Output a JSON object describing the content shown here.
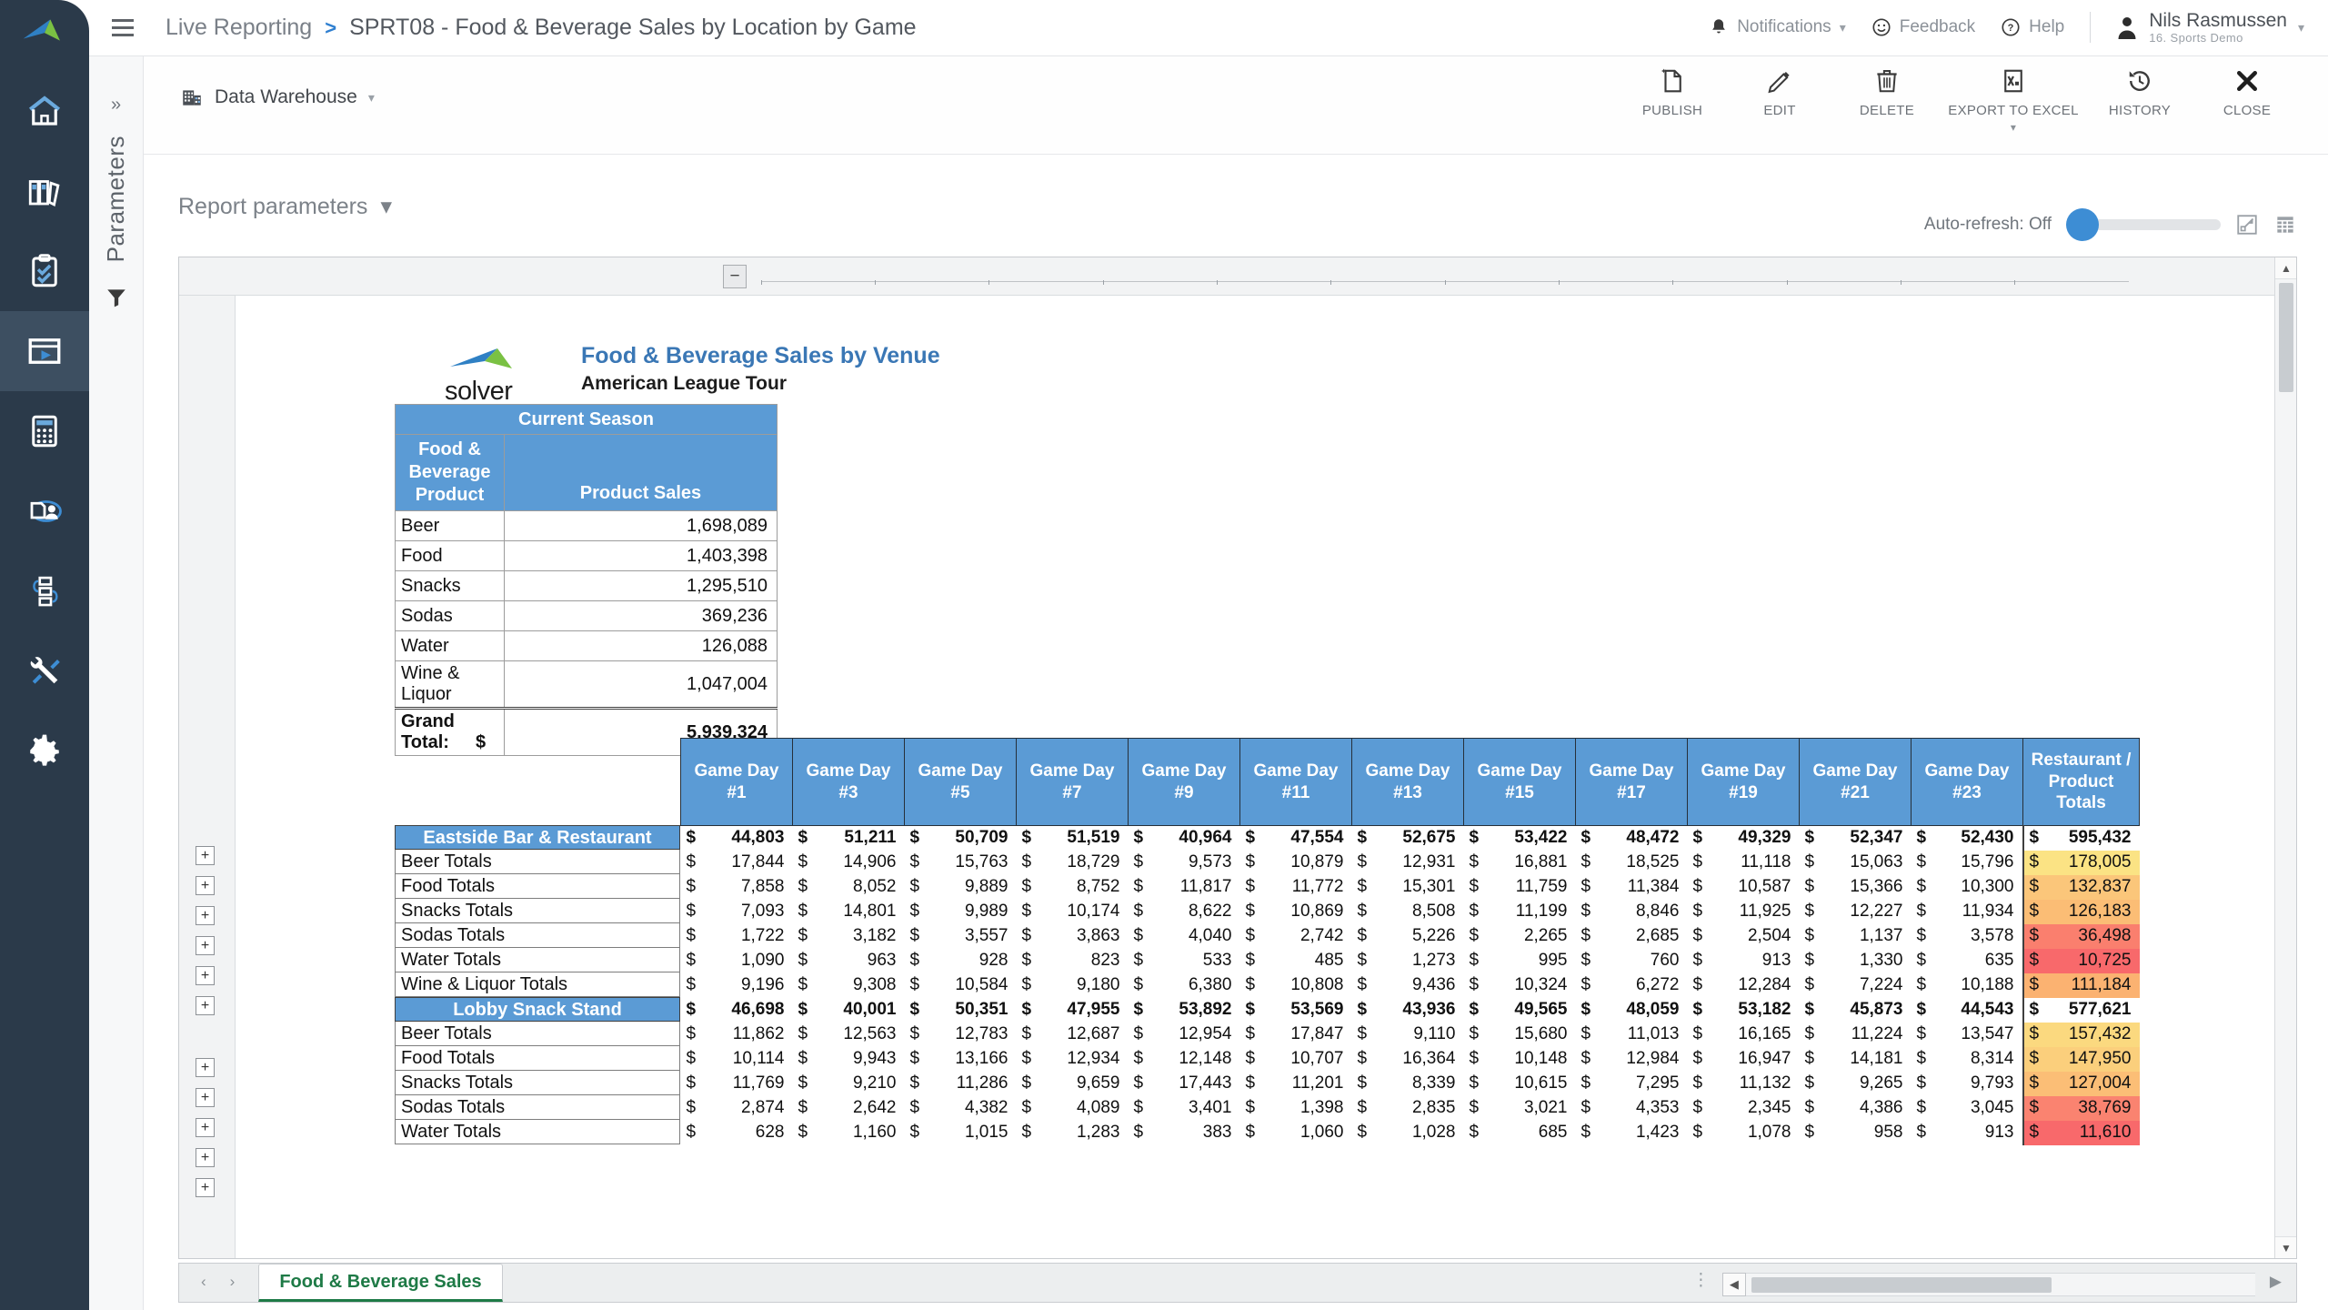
{
  "topbar": {
    "breadcrumb_root": "Live Reporting",
    "breadcrumb_sep": ">",
    "breadcrumb_current": "SPRT08 - Food & Beverage Sales by Location by Game",
    "notifications": "Notifications",
    "feedback": "Feedback",
    "help": "Help",
    "user_name": "Nils Rasmussen",
    "user_org": "16. Sports Demo"
  },
  "actionbar": {
    "datasource": "Data Warehouse",
    "actions": [
      {
        "label": "PUBLISH",
        "icon": "publish-icon"
      },
      {
        "label": "EDIT",
        "icon": "edit-icon"
      },
      {
        "label": "DELETE",
        "icon": "delete-icon"
      },
      {
        "label": "EXPORT TO EXCEL",
        "icon": "excel-icon"
      },
      {
        "label": "HISTORY",
        "icon": "history-icon"
      },
      {
        "label": "CLOSE",
        "icon": "close-icon"
      }
    ]
  },
  "parameters_panel": {
    "label": "Parameters"
  },
  "report": {
    "params_toggle": "Report parameters",
    "auto_refresh": "Auto-refresh: Off",
    "brand": "solver",
    "title": "Food & Beverage Sales by Venue",
    "subtitle": "American League Tour"
  },
  "summary": {
    "season_header": "Current Season",
    "col1_header": "Food & Beverage Product",
    "col2_header": "Product Sales",
    "rows": [
      {
        "label": "Beer",
        "value": "1,698,089"
      },
      {
        "label": "Food",
        "value": "1,403,398"
      },
      {
        "label": "Snacks",
        "value": "1,295,510"
      },
      {
        "label": "Sodas",
        "value": "369,236"
      },
      {
        "label": "Water",
        "value": "126,088"
      },
      {
        "label": "Wine & Liquor",
        "value": "1,047,004"
      }
    ],
    "total_label": "Grand Total:",
    "total_symbol": "$",
    "total_value": "5,939,324"
  },
  "chart_data": {
    "type": "table",
    "title": "Food & Beverage Sales by Venue",
    "columns": [
      "Game Day #1",
      "Game Day #3",
      "Game Day #5",
      "Game Day #7",
      "Game Day #9",
      "Game Day #11",
      "Game Day #13",
      "Game Day #15",
      "Game Day #17",
      "Game Day #19",
      "Game Day #21",
      "Game Day #23",
      "Restaurant / Product Totals"
    ],
    "currency_symbol": "$",
    "groups": [
      {
        "name": "Eastside Bar & Restaurant",
        "rows": [
          {
            "label": "Eastside Bar & Restaurant",
            "is_group_total": true,
            "values": [
              "44,803",
              "51,211",
              "50,709",
              "51,519",
              "40,964",
              "47,554",
              "52,675",
              "53,422",
              "48,472",
              "49,329",
              "52,347",
              "52,430"
            ],
            "total": "595,432",
            "total_color": "#ffffff"
          },
          {
            "label": "Beer Totals",
            "is_group_total": false,
            "values": [
              "17,844",
              "14,906",
              "15,763",
              "18,729",
              "9,573",
              "10,879",
              "12,931",
              "16,881",
              "18,525",
              "11,118",
              "15,063",
              "15,796"
            ],
            "total": "178,005",
            "total_color": "#fbe384"
          },
          {
            "label": "Food Totals",
            "is_group_total": false,
            "values": [
              "7,858",
              "8,052",
              "9,889",
              "8,752",
              "11,817",
              "11,772",
              "15,301",
              "11,759",
              "11,384",
              "10,587",
              "15,366",
              "10,300"
            ],
            "total": "132,837",
            "total_color": "#fbc67a"
          },
          {
            "label": "Snacks Totals",
            "is_group_total": false,
            "values": [
              "7,093",
              "14,801",
              "9,989",
              "10,174",
              "8,622",
              "10,869",
              "8,508",
              "11,199",
              "8,846",
              "11,925",
              "12,227",
              "11,934"
            ],
            "total": "126,183",
            "total_color": "#fbbd75"
          },
          {
            "label": "Sodas Totals",
            "is_group_total": false,
            "values": [
              "1,722",
              "3,182",
              "3,557",
              "3,863",
              "4,040",
              "2,742",
              "5,226",
              "2,265",
              "2,685",
              "2,504",
              "1,137",
              "3,578"
            ],
            "total": "36,498",
            "total_color": "#fa7f6e"
          },
          {
            "label": "Water Totals",
            "is_group_total": false,
            "values": [
              "1,090",
              "963",
              "928",
              "823",
              "533",
              "485",
              "1,273",
              "995",
              "760",
              "913",
              "1,330",
              "635"
            ],
            "total": "10,725",
            "total_color": "#f8696b"
          },
          {
            "label": "Wine & Liquor Totals",
            "is_group_total": false,
            "values": [
              "9,196",
              "9,308",
              "10,584",
              "9,180",
              "6,380",
              "10,808",
              "9,436",
              "10,324",
              "6,272",
              "12,284",
              "7,224",
              "10,188"
            ],
            "total": "111,184",
            "total_color": "#fbb271"
          }
        ]
      },
      {
        "name": "Lobby Snack Stand",
        "rows": [
          {
            "label": "Lobby Snack Stand",
            "is_group_total": true,
            "values": [
              "46,698",
              "40,001",
              "50,351",
              "47,955",
              "53,892",
              "53,569",
              "43,936",
              "49,565",
              "48,059",
              "53,182",
              "45,873",
              "44,543"
            ],
            "total": "577,621",
            "total_color": "#ffffff"
          },
          {
            "label": "Beer Totals",
            "is_group_total": false,
            "values": [
              "11,862",
              "12,563",
              "12,783",
              "12,687",
              "12,954",
              "17,847",
              "9,110",
              "15,680",
              "11,013",
              "16,165",
              "11,224",
              "13,547"
            ],
            "total": "157,432",
            "total_color": "#fbd97f"
          },
          {
            "label": "Food Totals",
            "is_group_total": false,
            "values": [
              "10,114",
              "9,943",
              "13,166",
              "12,934",
              "12,148",
              "10,707",
              "16,364",
              "10,148",
              "12,984",
              "16,947",
              "14,181",
              "8,314"
            ],
            "total": "147,950",
            "total_color": "#fbcf7c"
          },
          {
            "label": "Snacks Totals",
            "is_group_total": false,
            "values": [
              "11,769",
              "9,210",
              "11,286",
              "9,659",
              "17,443",
              "11,201",
              "8,339",
              "10,615",
              "7,295",
              "11,132",
              "9,265",
              "9,793"
            ],
            "total": "127,004",
            "total_color": "#fbbe76"
          },
          {
            "label": "Sodas Totals",
            "is_group_total": false,
            "values": [
              "2,874",
              "2,642",
              "4,382",
              "4,089",
              "3,401",
              "1,398",
              "2,835",
              "3,021",
              "4,353",
              "2,345",
              "4,386",
              "3,045"
            ],
            "total": "38,769",
            "total_color": "#fa8370"
          },
          {
            "label": "Water Totals",
            "is_group_total": false,
            "values": [
              "628",
              "1,160",
              "1,015",
              "1,283",
              "383",
              "1,060",
              "1,028",
              "685",
              "1,423",
              "1,078",
              "958",
              "913"
            ],
            "total": "11,610",
            "total_color": "#f8696b"
          }
        ]
      }
    ]
  },
  "sheetbar": {
    "prev_arrow": "‹",
    "next_arrow": "›",
    "tab_name": "Food & Beverage Sales",
    "dots": "⋮"
  }
}
